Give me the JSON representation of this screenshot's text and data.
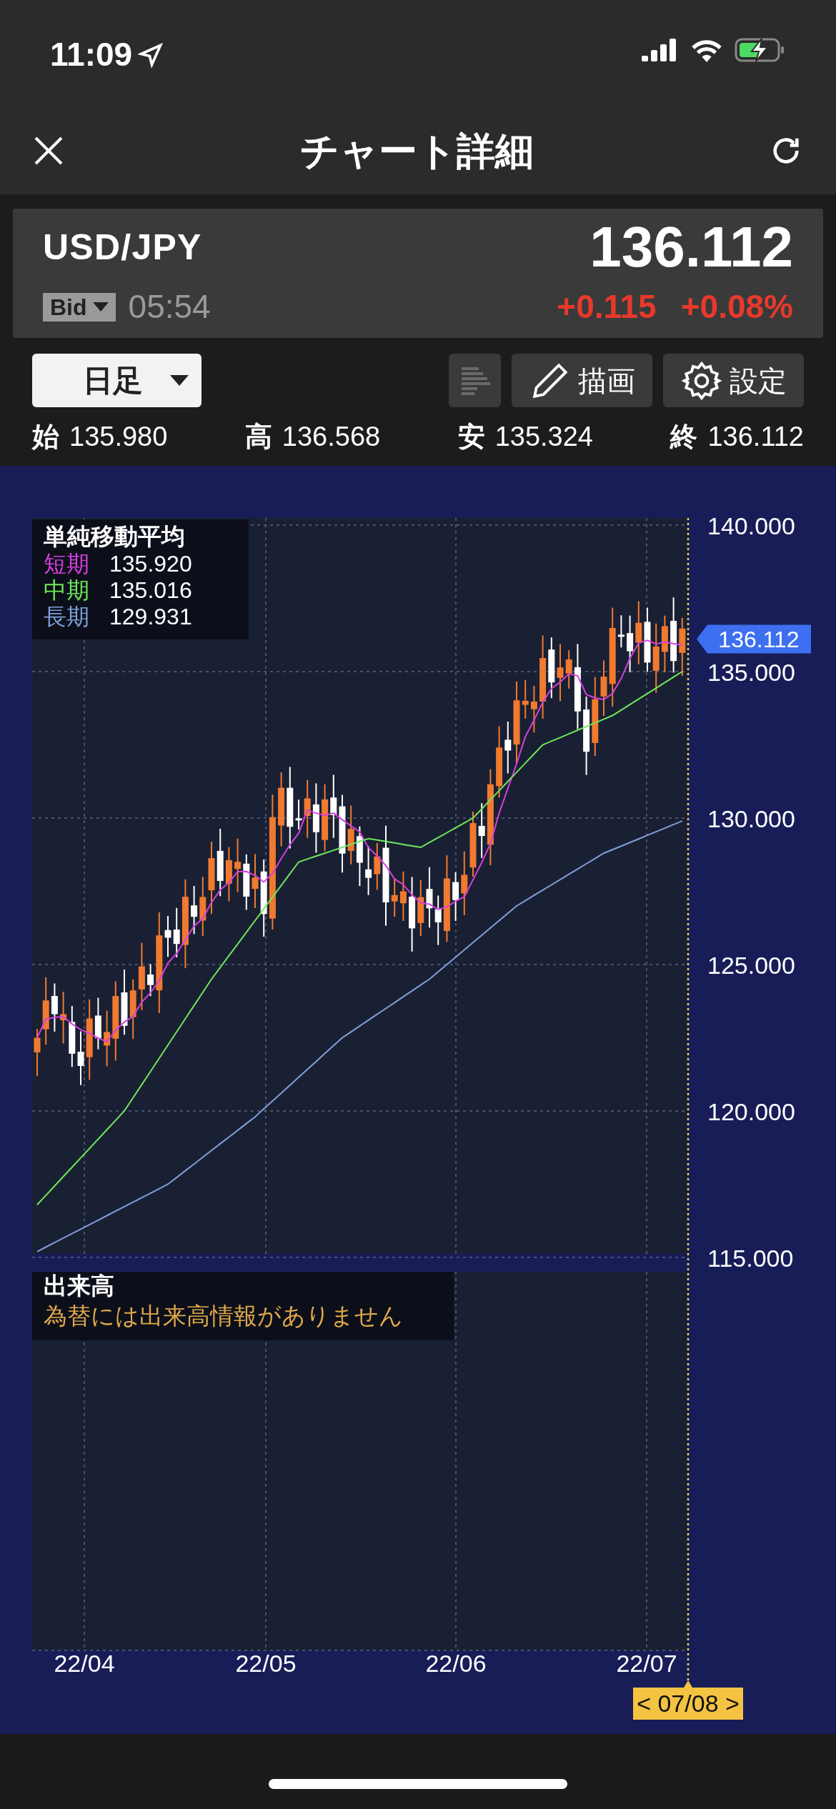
{
  "status_bar": {
    "time": "11:09"
  },
  "header": {
    "title": "チャート詳細"
  },
  "quote": {
    "pair": "USD/JPY",
    "price": "136.112",
    "price_type": "Bid",
    "time": "05:54",
    "change": "+0.115",
    "change_percent": "+0.08%"
  },
  "toolbar": {
    "period": "日足",
    "buttons": [
      {
        "kind": "list",
        "disabled": true
      },
      {
        "kind": "draw",
        "label": "描画",
        "disabled": false
      },
      {
        "kind": "settings",
        "label": "設定",
        "disabled": false
      }
    ]
  },
  "ohlc": [
    {
      "label": "始",
      "value": "135.980"
    },
    {
      "label": "高",
      "value": "136.568"
    },
    {
      "label": "安",
      "value": "135.324"
    },
    {
      "label": "終",
      "value": "136.112"
    }
  ],
  "chart": {
    "legend": {
      "title": "単純移動平均",
      "lines": [
        {
          "label": "短期",
          "value": "135.920",
          "color": "#d63fe0"
        },
        {
          "label": "中期",
          "value": "135.016",
          "color": "#6ee85a"
        },
        {
          "label": "長期",
          "value": "129.931",
          "color": "#7f9fd8"
        }
      ]
    },
    "y_labels": [
      "140.000",
      "135.000",
      "130.000",
      "125.000",
      "120.000",
      "115.000"
    ],
    "x_labels": [
      "22/04",
      "22/05",
      "22/06",
      "22/07"
    ],
    "current_price": "136.112",
    "cursor_date": "< 07/08 >"
  },
  "volume": {
    "title": "出来高",
    "message": "為替には出来高情報がありません"
  }
}
